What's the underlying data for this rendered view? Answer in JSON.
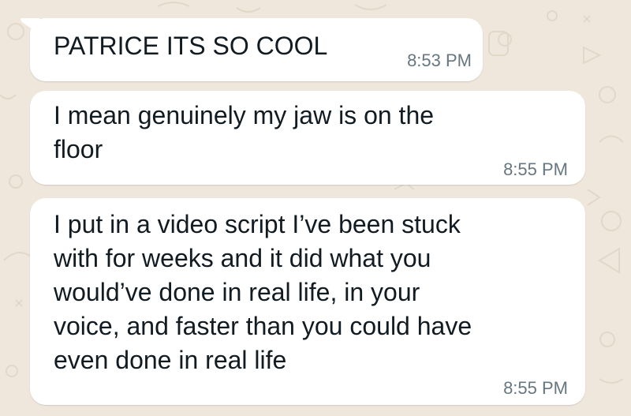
{
  "chat": {
    "messages": [
      {
        "text": "PATRICE ITS SO COOL",
        "time": "8:53 PM"
      },
      {
        "text": "I mean genuinely my jaw is on the\nfloor",
        "time": "8:55 PM"
      },
      {
        "text": "I put in a video script I’ve been stuck\nwith for weeks and it did what you\nwould’ve done in real life, in your\nvoice, and faster than you could have\neven done in real life",
        "time": "8:55 PM"
      }
    ]
  },
  "colors": {
    "wallpaper": "#efe7dc",
    "bubble": "#ffffff",
    "text": "#111b21",
    "timestamp": "#667781"
  }
}
